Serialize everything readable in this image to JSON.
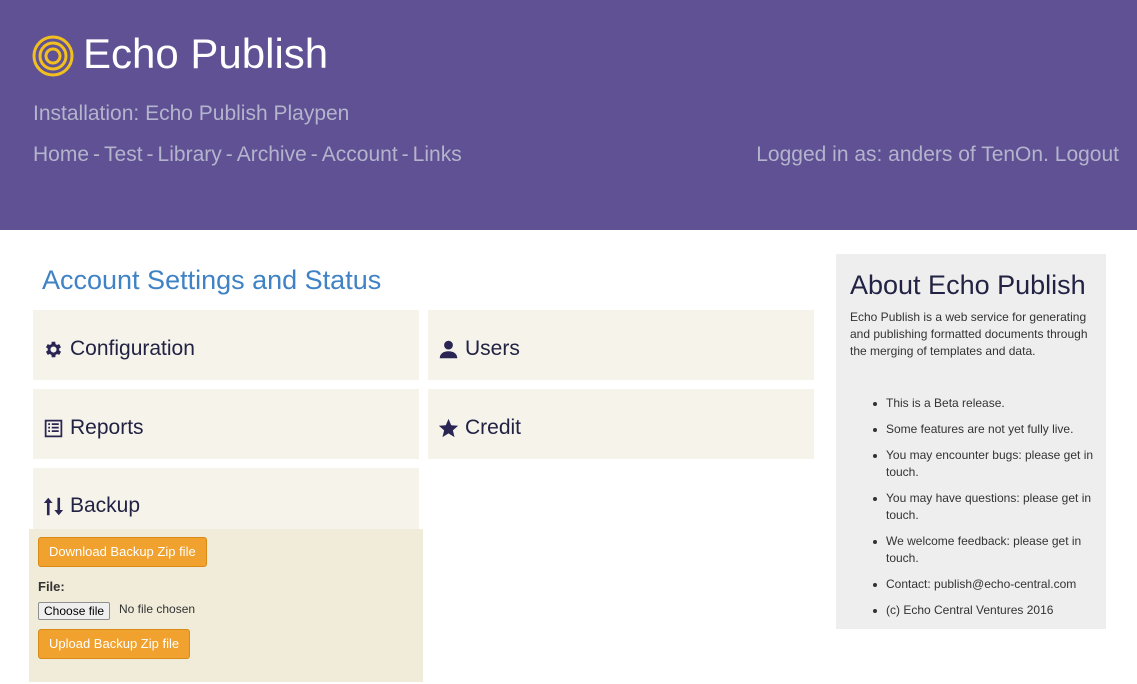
{
  "header": {
    "app_title": "Echo Publish",
    "installation": "Installation: Echo Publish Playpen",
    "nav": [
      "Home",
      "Test",
      "Library",
      "Archive",
      "Account",
      "Links"
    ],
    "nav_separator": "-",
    "login_text": "Logged in as: anders of TenOn.",
    "logout_label": "Logout"
  },
  "main": {
    "title": "Account Settings and Status",
    "panels": {
      "configuration": "Configuration",
      "users": "Users",
      "reports": "Reports",
      "credit": "Credit",
      "backup": "Backup"
    },
    "backup": {
      "download_label": "Download Backup Zip file",
      "file_label": "File:",
      "choose_file_label": "Choose file",
      "no_file_text": "No file chosen",
      "upload_label": "Upload Backup Zip file"
    }
  },
  "about": {
    "title": "About Echo Publish",
    "description": "Echo Publish is a web service for generating and publishing formatted documents through the merging of templates and data.",
    "items": [
      "This is a Beta release.",
      "Some features are not yet fully live.",
      "You may encounter bugs: please get in touch.",
      "You may have questions: please get in touch.",
      "We welcome feedback: please get in touch.",
      "Contact: publish@echo-central.com",
      "(c) Echo Central Ventures 2016"
    ]
  },
  "colors": {
    "header_bg": "#5f5194",
    "accent_title": "#3f82c5",
    "button_orange": "#f0a12e",
    "logo_yellow": "#f2c01e"
  },
  "icons": {
    "logo": "concentric-circles-icon",
    "configuration": "gear-icon",
    "users": "user-icon",
    "reports": "list-icon",
    "credit": "star-icon",
    "backup": "sort-arrows-icon"
  }
}
